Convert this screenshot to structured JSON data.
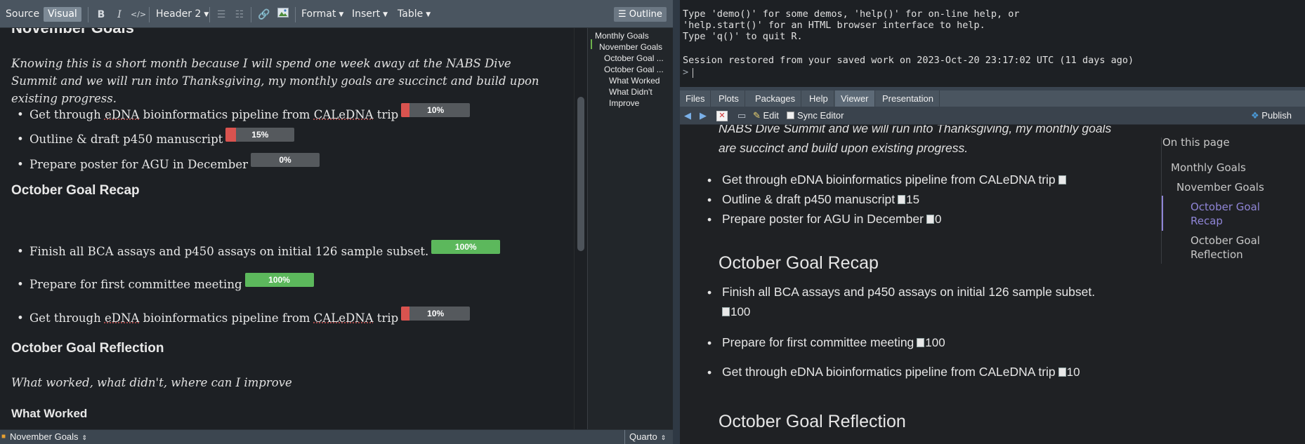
{
  "toolbar": {
    "source": "Source",
    "visual": "Visual",
    "bold": "B",
    "italic": "I",
    "code": "</>",
    "style": "Header 2",
    "format": "Format",
    "insert": "Insert",
    "table": "Table",
    "outline": "Outline"
  },
  "doc": {
    "h_nov": "November Goals",
    "nov_intro": "Knowing this is a short month because I will spend one week away at the NABS Dive Summit and we will run into Thanksgiving, my monthly goals are succinct and build upon existing progress.",
    "nov_items": [
      {
        "pre": "Get through ",
        "u1": "eDNA",
        "mid": " bioinformatics pipeline from ",
        "u2": "CALeDNA",
        "post": " trip",
        "progress": 10,
        "label": "10%"
      },
      {
        "text": "Outline & draft p450 manuscript",
        "progress": 15,
        "label": "15%"
      },
      {
        "text": "Prepare poster for AGU in December",
        "progress": 0,
        "label": "0%"
      }
    ],
    "h_oct": "October Goal Recap",
    "oct_items": [
      {
        "text": "Finish all BCA assays and p450 assays on initial 126 sample subset.",
        "progress": 100,
        "label": "100%"
      },
      {
        "text": "Prepare for first committee meeting",
        "progress": 100,
        "label": "100%"
      },
      {
        "pre": "Get through ",
        "u1": "eDNA",
        "mid": " bioinformatics pipeline from ",
        "u2": "CALeDNA",
        "post": " trip",
        "progress": 10,
        "label": "10%"
      }
    ],
    "h_refl": "October Goal Reflection",
    "refl_text": "What worked, what didn't, where can I improve",
    "h_worked": "What Worked"
  },
  "outline": [
    "Monthly Goals",
    "November Goals",
    "October Goal ...",
    "October Goal ...",
    "What Worked",
    "What Didn't",
    "Improve"
  ],
  "status": {
    "section": "November Goals",
    "mode": "Quarto"
  },
  "console": {
    "lines": [
      "Type 'demo()' for some demos, 'help()' for on-line help, or",
      "'help.start()' for an HTML browser interface to help.",
      "Type 'q()' to quit R.",
      "",
      "Session restored from your saved work on 2023-Oct-20 23:17:02 UTC (11 days ago)"
    ],
    "prompt": ">"
  },
  "tabs": [
    "Files",
    "Plots",
    "Packages",
    "Help",
    "Viewer",
    "Presentation"
  ],
  "viewer_toolbar": {
    "edit": "Edit",
    "sync": "Sync Editor",
    "publish": "Publish"
  },
  "viewer": {
    "intro_l1": "NABS Dive Summit and we will run into Thanksgiving, my monthly goals",
    "intro_l2": "are succinct and build upon existing progress.",
    "nov_items": [
      {
        "text": "Get through eDNA bioinformatics pipeline from CALeDNA trip",
        "alt": ""
      },
      {
        "text": "Outline & draft p450 manuscript",
        "alt": "15"
      },
      {
        "text": "Prepare poster for AGU in December",
        "alt": "0"
      }
    ],
    "h_oct": "October Goal Recap",
    "oct_item1_l1": "Finish all BCA assays and p450 assays on initial 126 sample subset.",
    "oct_item1_alt": "100",
    "oct_item2": "Prepare for first committee meeting",
    "oct_item2_alt": "100",
    "oct_item3": "Get through eDNA bioinformatics pipeline from CALeDNA trip",
    "oct_item3_alt": "10",
    "h_refl": "October Goal Reflection"
  },
  "toc": {
    "title": "On this page",
    "items": [
      "Monthly Goals",
      "November Goals",
      "October Goal",
      "Recap",
      "October Goal",
      "Reflection"
    ]
  }
}
